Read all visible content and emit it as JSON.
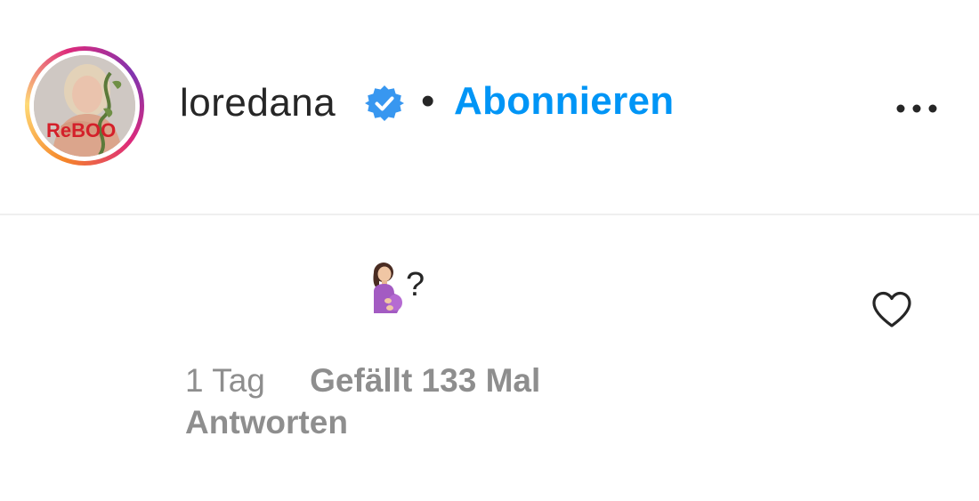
{
  "header": {
    "username": "loredana",
    "separator": "•",
    "follow_label": "Abonnieren",
    "verified_icon": "verified-badge-icon",
    "more_icon": "more-options-icon",
    "avatar_overlay_text": "ReBOO",
    "colors": {
      "follow": "#0095f6",
      "verified": "#3897f0",
      "text": "#262626"
    }
  },
  "comment": {
    "text": "?",
    "emoji_icon": "pregnant-woman-emoji-icon",
    "like_icon": "heart-outline-icon",
    "time": "1 Tag",
    "likes": "Gefällt 133 Mal",
    "reply_label": "Antworten",
    "colors": {
      "meta": "#8e8e8e"
    }
  }
}
